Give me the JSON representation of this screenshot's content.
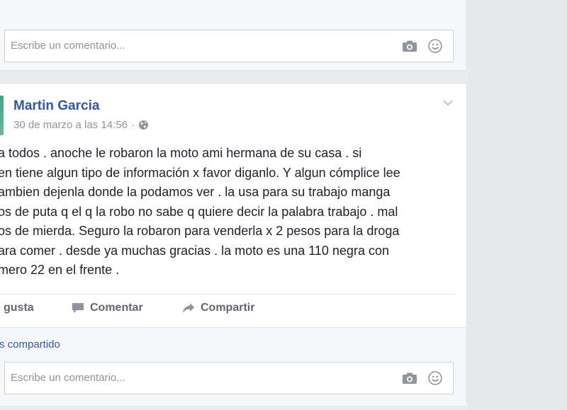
{
  "top_comment": {
    "placeholder": "Escribe un comentario..."
  },
  "post": {
    "author": "Martin Garcia",
    "timestamp": "30 de marzo a las 14:56",
    "separator": "·",
    "text_lines": [
      "a todos . anoche le robaron la moto ami hermana de su casa . si",
      "en tiene algun tipo de información x favor diganlo. Y algun cómplice lee",
      "ambien dejenla donde la podamos ver . la usa para su trabajo manga",
      "os de puta q el q la robo no sabe q quiere decir la palabra trabajo . mal",
      "os de mierda. Seguro la robaron para venderla x 2 pesos para la droga",
      "ara comer . desde ya muchas gracias . la moto es una 110 negra con",
      "mero 22 en el frente ."
    ],
    "actions": {
      "like": "gusta",
      "comment": "Comentar",
      "share": "Compartir"
    },
    "shared_label": "s compartido",
    "comment_placeholder": "Escribe un comentario..."
  },
  "icons": [
    "camera-icon",
    "smiley-icon",
    "globe-icon",
    "chevron-down-icon",
    "comment-icon",
    "share-arrow-icon"
  ],
  "colors": {
    "author_link": "#365899",
    "muted_text": "#90949c",
    "page_bg": "#e9ebee",
    "action_text": "#606770"
  }
}
